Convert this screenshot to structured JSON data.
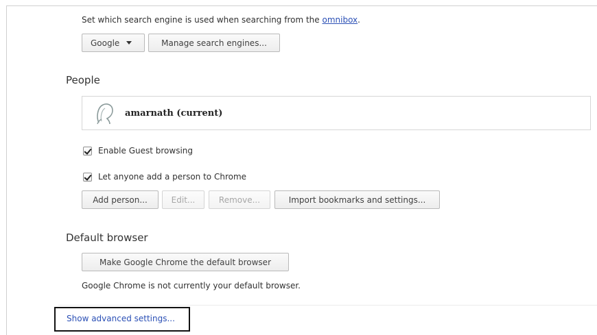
{
  "search": {
    "description_prefix": "Set which search engine is used when searching from the ",
    "omnibox_link": "omnibox",
    "description_suffix": ".",
    "engine_selected": "Google",
    "manage_button": "Manage search engines..."
  },
  "people": {
    "section_title": "People",
    "current_profile": "amarnath (current)",
    "guest_browsing_label": "Enable Guest browsing",
    "guest_browsing_checked": true,
    "add_person_label": "Let anyone add a person to Chrome",
    "add_person_checked": true,
    "buttons": {
      "add_person": "Add person...",
      "edit": "Edit...",
      "remove": "Remove...",
      "import": "Import bookmarks and settings..."
    }
  },
  "default_browser": {
    "section_title": "Default browser",
    "make_default_button": "Make Google Chrome the default browser",
    "status_text": "Google Chrome is not currently your default browser."
  },
  "footer": {
    "advanced_link": "Show advanced settings..."
  },
  "icons": {
    "profile": "person-silhouette-icon",
    "dropdown": "chevron-down-icon",
    "checkbox": "checkmark-icon"
  },
  "colors": {
    "link": "#2a4fb5",
    "highlight_border": "#111111"
  }
}
